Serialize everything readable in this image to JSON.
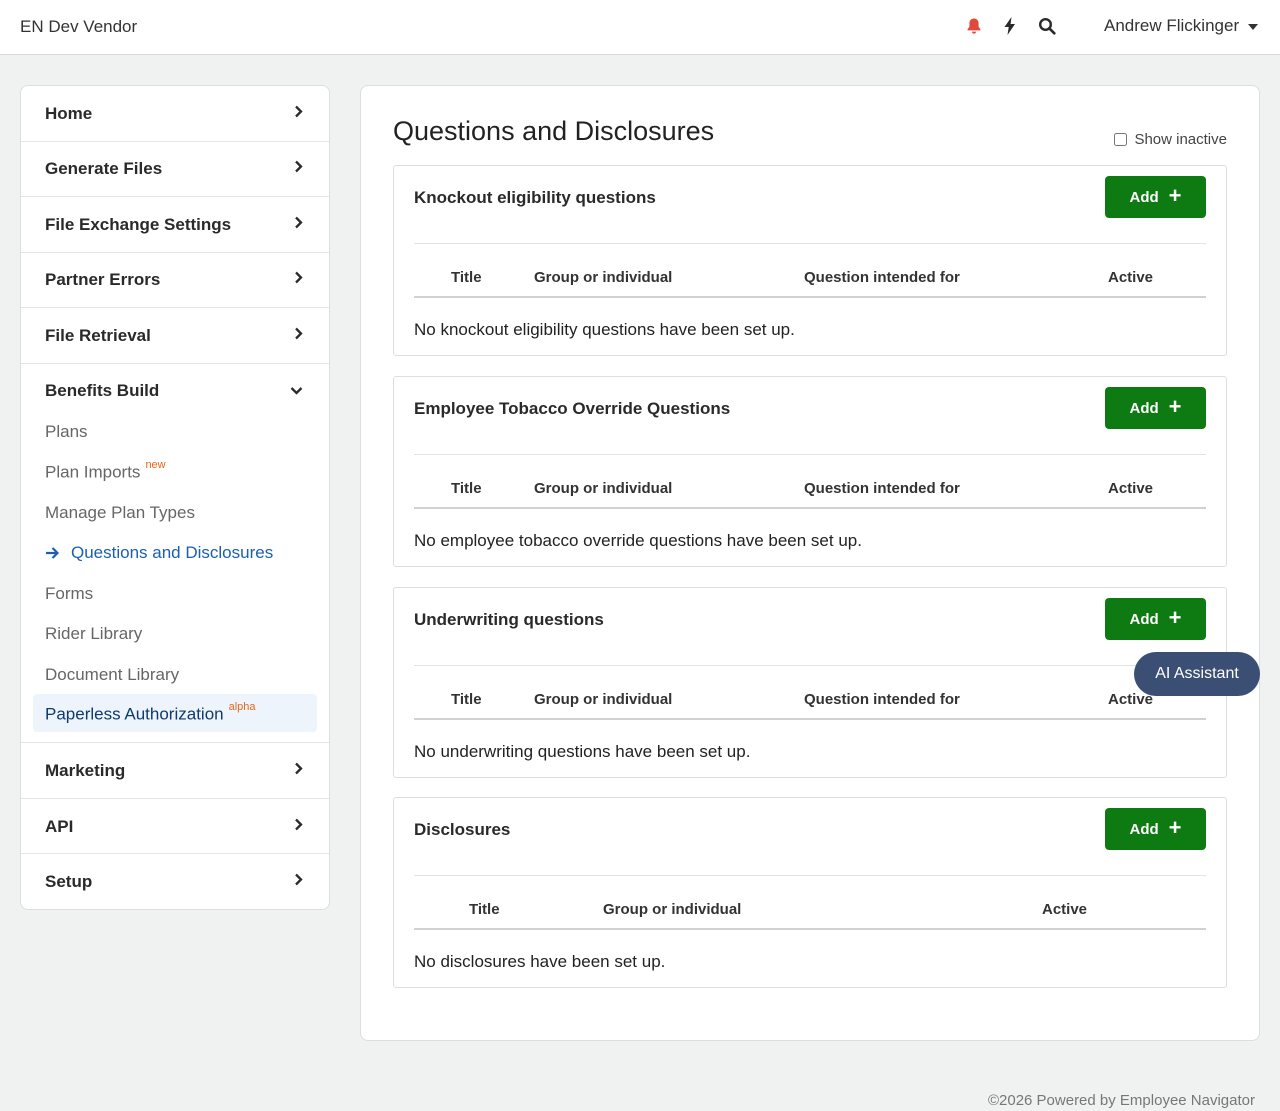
{
  "header": {
    "brand": "EN Dev Vendor",
    "user_name": "Andrew Flickinger",
    "icons": {
      "notifications": "bell-icon",
      "quick_actions": "bolt-icon",
      "search": "search-icon"
    },
    "notification_color": "#e04a3b"
  },
  "sidebar": {
    "sections": [
      {
        "label": "Home",
        "icon": "chevron-right-icon"
      },
      {
        "label": "Generate Files",
        "icon": "chevron-right-icon"
      },
      {
        "label": "File Exchange Settings",
        "icon": "chevron-right-icon"
      },
      {
        "label": "Partner Errors",
        "icon": "chevron-right-icon"
      },
      {
        "label": "File Retrieval",
        "icon": "chevron-right-icon"
      },
      {
        "label": "Benefits Build",
        "icon": "chevron-down-icon",
        "expanded": true
      },
      {
        "label": "Marketing",
        "icon": "chevron-right-icon"
      },
      {
        "label": "API",
        "icon": "chevron-right-icon"
      },
      {
        "label": "Setup",
        "icon": "chevron-right-icon"
      }
    ],
    "sub_items": [
      {
        "label": "Plans"
      },
      {
        "label": "Plan Imports",
        "badge": "new"
      },
      {
        "label": "Manage Plan Types"
      },
      {
        "label": "Questions and Disclosures",
        "active": true
      },
      {
        "label": "Forms"
      },
      {
        "label": "Rider Library"
      },
      {
        "label": "Document Library"
      },
      {
        "label": "Paperless Authorization",
        "badge": "alpha",
        "highlighted": true
      }
    ]
  },
  "main": {
    "title": "Questions and Disclosures",
    "show_inactive_label": "Show inactive",
    "show_inactive_checked": false,
    "add_label": "Add",
    "cards": [
      {
        "title": "Knockout eligibility questions",
        "columns": [
          "Title",
          "Group or individual",
          "Question intended for",
          "Active"
        ],
        "empty_message": "No knockout eligibility questions have been set up."
      },
      {
        "title": "Employee Tobacco Override Questions",
        "columns": [
          "Title",
          "Group or individual",
          "Question intended for",
          "Active"
        ],
        "empty_message": "No employee tobacco override questions have been set up."
      },
      {
        "title": "Underwriting questions",
        "columns": [
          "Title",
          "Group or individual",
          "Question intended for",
          "Active"
        ],
        "empty_message": "No underwriting questions have been set up."
      },
      {
        "title": "Disclosures",
        "columns": [
          "Title",
          "Group or individual",
          "Active"
        ],
        "empty_message": "No disclosures have been set up."
      }
    ]
  },
  "ai_assistant_label": "AI Assistant",
  "footer": "©2026 Powered by Employee Navigator",
  "colors": {
    "accent_green": "#0e7a12",
    "active_link": "#1b5fb3",
    "badge_orange": "#e8661c",
    "ai_button": "#3a4f73"
  }
}
